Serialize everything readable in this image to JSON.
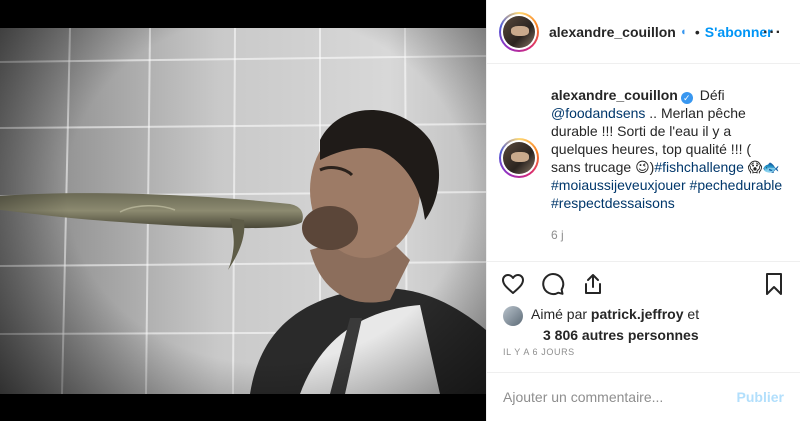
{
  "header": {
    "username": "alexandre_couillon",
    "separator": "•",
    "follow_label": "S'abonner",
    "more_icon": "more-horizontal-icon",
    "verified_icon": "verified-icon"
  },
  "caption": {
    "username": "alexandre_couillon",
    "verified_icon": "verified-icon",
    "text_1": "Défi",
    "mention": "@foodandsens",
    "text_2": " .. Merlan pêche durable !!! Sorti de l'eau il y a quelques heures, top qualité !!! ( sans trucage ",
    "emoji_1": "😉",
    "text_3": ")",
    "hashtag_1": "#fishchallenge",
    "emoji_2": " 😱🐟",
    "hashtag_2": "#moiaussijeveuxjouer",
    "hashtag_3": "#pechedurable",
    "hashtag_4": "#respectdessaisons",
    "age": "6 j"
  },
  "actions": {
    "like_icon": "heart-icon",
    "comment_icon": "comment-icon",
    "share_icon": "share-icon",
    "save_icon": "bookmark-icon"
  },
  "likes": {
    "prefix": "Aimé par ",
    "user": "patrick.jeffroy",
    "suffix": " et",
    "others": "3 806 autres personnes"
  },
  "timestamp": "IL Y A 6 JOURS",
  "comment": {
    "placeholder": "Ajouter un commentaire...",
    "post_label": "Publier"
  },
  "colors": {
    "accent": "#0095f6",
    "hashtag": "#00376b",
    "muted": "#8e8e8e",
    "post_disabled": "#b2dffc"
  }
}
